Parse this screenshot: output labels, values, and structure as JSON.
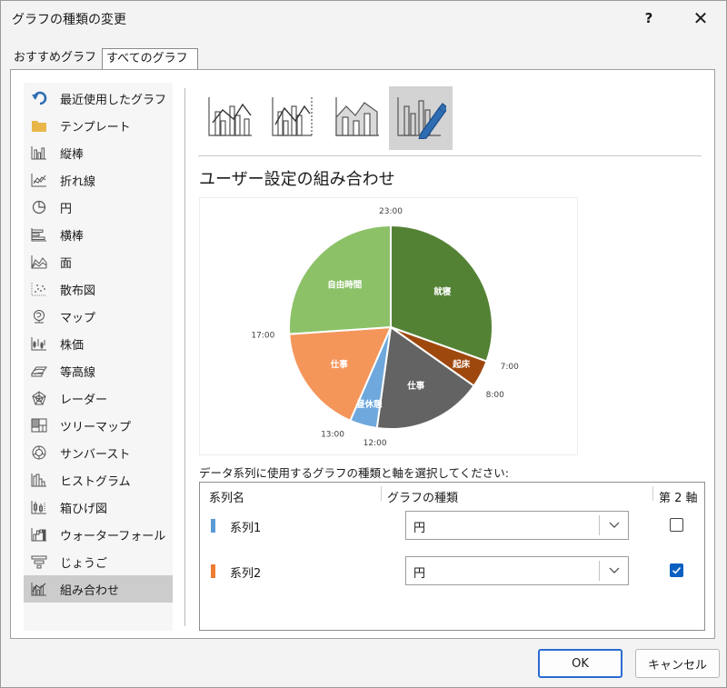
{
  "window": {
    "title": "グラフの種類の変更",
    "help_label": "?",
    "close_label": "✕"
  },
  "tabs": [
    {
      "label": "おすすめグラフ",
      "selected": false
    },
    {
      "label": "すべてのグラフ",
      "selected": true
    }
  ],
  "sidebar": {
    "items": [
      {
        "label": "最近使用したグラフ",
        "icon": "undo-arrow-icon"
      },
      {
        "label": "テンプレート",
        "icon": "folder-icon"
      },
      {
        "label": "縦棒",
        "icon": "column-chart-icon"
      },
      {
        "label": "折れ線",
        "icon": "line-chart-icon"
      },
      {
        "label": "円",
        "icon": "pie-chart-icon"
      },
      {
        "label": "横棒",
        "icon": "bar-chart-icon"
      },
      {
        "label": "面",
        "icon": "area-chart-icon"
      },
      {
        "label": "散布図",
        "icon": "scatter-chart-icon"
      },
      {
        "label": "マップ",
        "icon": "map-globe-icon"
      },
      {
        "label": "株価",
        "icon": "stock-chart-icon"
      },
      {
        "label": "等高線",
        "icon": "surface-chart-icon"
      },
      {
        "label": "レーダー",
        "icon": "radar-chart-icon"
      },
      {
        "label": "ツリーマップ",
        "icon": "treemap-icon"
      },
      {
        "label": "サンバースト",
        "icon": "sunburst-icon"
      },
      {
        "label": "ヒストグラム",
        "icon": "histogram-icon"
      },
      {
        "label": "箱ひげ図",
        "icon": "box-whisker-icon"
      },
      {
        "label": "ウォーターフォール",
        "icon": "waterfall-icon"
      },
      {
        "label": "じょうご",
        "icon": "funnel-icon"
      },
      {
        "label": "組み合わせ",
        "icon": "combo-chart-icon",
        "selected": true
      }
    ]
  },
  "combo_types": [
    {
      "icon": "clustered-column-line-icon",
      "selected": false
    },
    {
      "icon": "clustered-column-line-secondary-icon",
      "selected": false
    },
    {
      "icon": "stacked-area-column-icon",
      "selected": false
    },
    {
      "icon": "custom-combo-icon",
      "selected": true
    }
  ],
  "main": {
    "heading": "ユーザー設定の組み合わせ"
  },
  "chart_data": {
    "type": "pie",
    "title": "",
    "slices": [
      {
        "label": "就寝",
        "value": 7,
        "color": "#548235"
      },
      {
        "label": "起床",
        "value": 1,
        "color": "#9e480e"
      },
      {
        "label": "仕事",
        "value": 4,
        "color": "#636363"
      },
      {
        "label": "昼休憩",
        "value": 1,
        "color": "#6fa8dc"
      },
      {
        "label": "仕事",
        "value": 4,
        "color": "#f4955a"
      },
      {
        "label": "自由時間",
        "value": 6,
        "color": "#8cc168"
      }
    ],
    "outer_labels": [
      {
        "label": "23:00",
        "at_boundary": 0
      },
      {
        "label": "7:00",
        "at_boundary": 7
      },
      {
        "label": "8:00",
        "at_boundary": 8
      },
      {
        "label": "12:00",
        "at_boundary": 12
      },
      {
        "label": "13:00",
        "at_boundary": 13
      },
      {
        "label": "17:00",
        "at_boundary": 17
      }
    ]
  },
  "series_panel": {
    "prompt": "データ系列に使用するグラフの種類と軸を選択してください:",
    "headers": {
      "name": "系列名",
      "type": "グラフの種類",
      "axis": "第 2 軸"
    },
    "rows": [
      {
        "name": "系列1",
        "color": "#5b9bd5",
        "type": "円",
        "secondary": false
      },
      {
        "name": "系列2",
        "color": "#ed7d31",
        "type": "円",
        "secondary": true
      }
    ]
  },
  "buttons": {
    "ok": "OK",
    "cancel": "キャンセル"
  }
}
